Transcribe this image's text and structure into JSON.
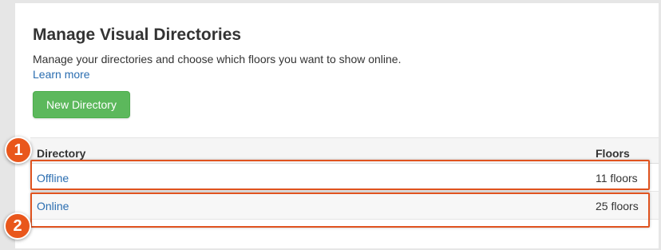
{
  "page": {
    "title": "Manage Visual Directories",
    "description": "Manage your directories and choose which floors you want to show online.",
    "learn_more": "Learn more",
    "new_directory_button": "New Directory"
  },
  "table": {
    "columns": [
      "Directory",
      "Floors"
    ],
    "rows": [
      {
        "name": "Offline",
        "floors": "11 floors"
      },
      {
        "name": "Online",
        "floors": "25 floors"
      }
    ]
  },
  "annotations": {
    "markers": [
      "1",
      "2"
    ],
    "highlight_color": "#e0531f"
  },
  "colors": {
    "primary_button": "#5cb85c",
    "link": "#2a6db0",
    "marker": "#e9571c"
  }
}
